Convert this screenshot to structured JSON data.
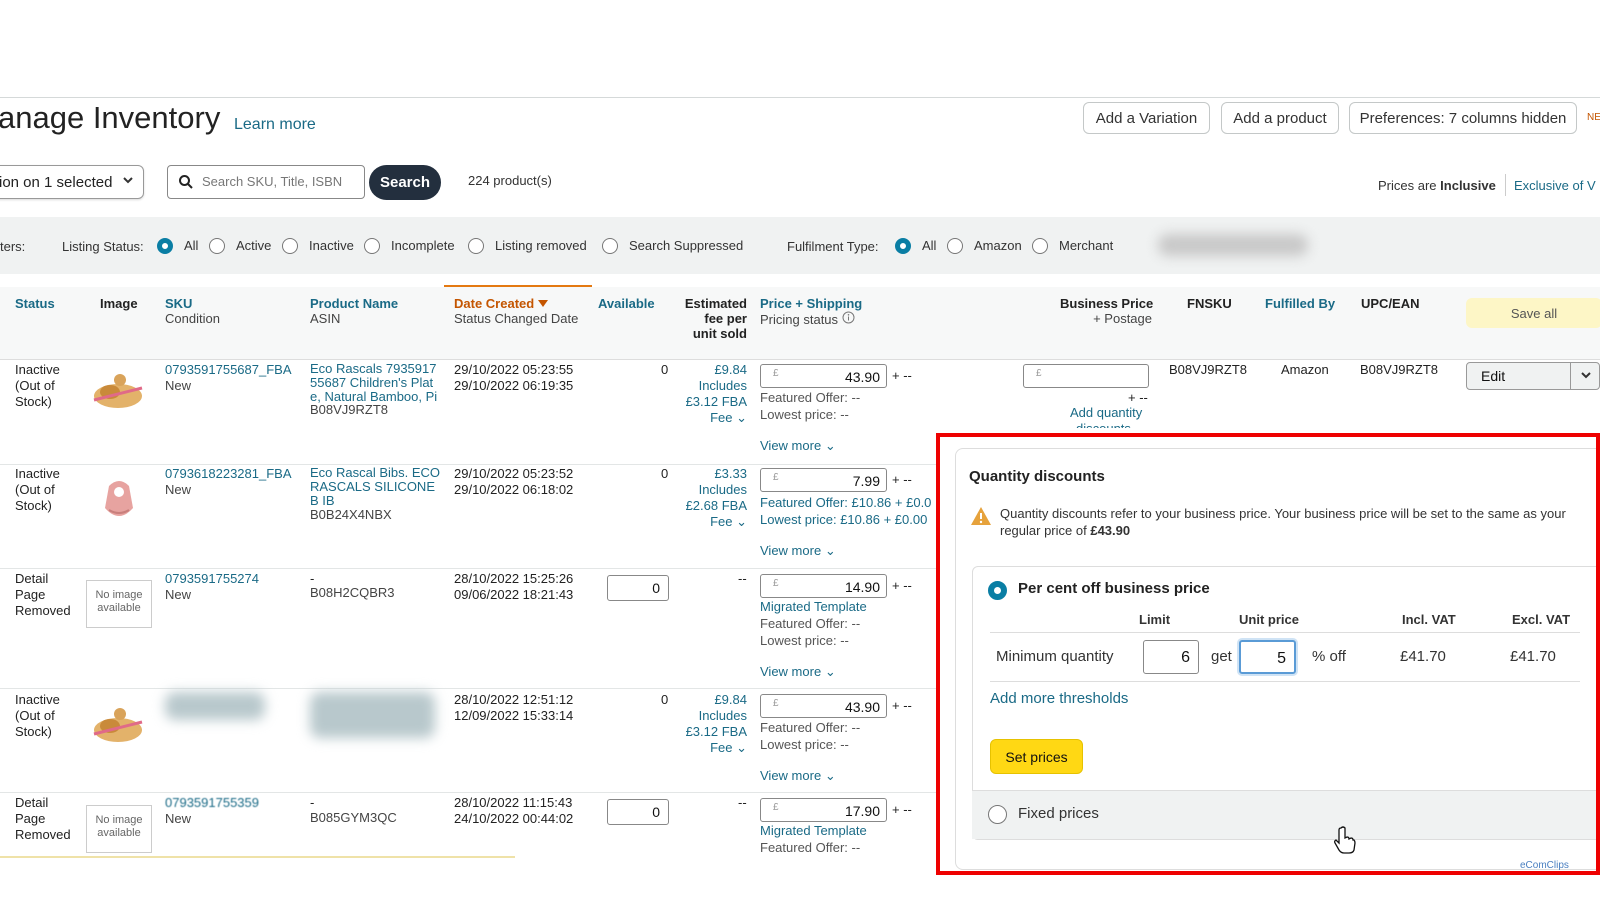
{
  "header": {
    "title": "anage Inventory",
    "learn_more": "Learn more",
    "add_variation": "Add a Variation",
    "add_product": "Add a product",
    "preferences": "Preferences: 7 columns hidden",
    "new_badge": "NE"
  },
  "toolbar": {
    "action_select": "ion on 1 selected",
    "search_placeholder": "Search SKU, Title, ISBN",
    "search_button": "Search",
    "product_count": "224 product(s)",
    "prices_are": "Prices are",
    "prices_inclusive": "Inclusive",
    "exclusive_link": "Exclusive of V"
  },
  "filters": {
    "filters_label": "ters:",
    "listing_status_label": "Listing Status:",
    "listing_options": [
      "All",
      "Active",
      "Inactive",
      "Incomplete",
      "Listing removed",
      "Search Suppressed"
    ],
    "listing_selected": "All",
    "fulfilment_label": "Fulfilment Type:",
    "fulfilment_options": [
      "All",
      "Amazon",
      "Merchant"
    ],
    "fulfilment_selected": "All"
  },
  "table": {
    "headers": {
      "status": "Status",
      "image": "Image",
      "sku": "SKU",
      "condition": "Condition",
      "product_name": "Product Name",
      "asin": "ASIN",
      "date_created": "Date Created",
      "status_changed": "Status Changed Date",
      "available": "Available",
      "fee_1": "Estimated",
      "fee_2": "fee per",
      "fee_3": "unit sold",
      "price_shipping": "Price + Shipping",
      "pricing_status": "Pricing status",
      "business_price": "Business Price",
      "postage": "+ Postage",
      "fnsku": "FNSKU",
      "fulfilled_by": "Fulfilled By",
      "upc": "UPC/EAN",
      "save_all": "Save all"
    },
    "rows": [
      {
        "status": [
          "Inactive",
          "(Out of",
          "Stock)"
        ],
        "sku": "0793591755687_FBA",
        "condition": "New",
        "name": "Eco Rascals 7935917 55687 Children's Plat e, Natural Bamboo, Pi",
        "asin": "B08VJ9RZT8",
        "date_created": "29/10/2022 05:23:55",
        "date_changed": "29/10/2022 06:19:35",
        "available": "0",
        "fee": [
          "£9.84",
          "Includes",
          "£3.12 FBA",
          "Fee"
        ],
        "price": "43.90",
        "shipping": "+ --",
        "offer1": "Featured Offer: --",
        "offer2": "Lowest price: --",
        "view_more": "View more"
      },
      {
        "status": [
          "Inactive",
          "(Out of",
          "Stock)"
        ],
        "sku": "0793618223281_FBA",
        "condition": "New",
        "name": "Eco Rascal Bibs. ECO RASCALS SILICONE B IB",
        "asin": "B0B24X4NBX",
        "date_created": "29/10/2022 05:23:52",
        "date_changed": "29/10/2022 06:18:02",
        "available": "0",
        "fee": [
          "£3.33",
          "Includes",
          "£2.68 FBA",
          "Fee"
        ],
        "price": "7.99",
        "shipping": "+ --",
        "offer1": "Featured Offer: £10.86 + £0.0",
        "offer2": "Lowest price: £10.86 + £0.00",
        "view_more": "View more"
      },
      {
        "status": [
          "Detail",
          "Page",
          "Removed"
        ],
        "no_image": [
          "No image",
          "available"
        ],
        "sku": "0793591755274",
        "condition": "New",
        "name": "-",
        "asin": "B08H2CQBR3",
        "date_created": "28/10/2022 15:25:26",
        "date_changed": "09/06/2022 18:21:43",
        "available": "0",
        "fee_dash": "--",
        "price": "14.90",
        "shipping": "+ --",
        "template": "Migrated Template",
        "offer1": "Featured Offer: --",
        "offer2": "Lowest price: --",
        "view_more": "View more"
      },
      {
        "status": [
          "Inactive",
          "(Out of",
          "Stock)"
        ],
        "date_created": "28/10/2022 12:51:12",
        "date_changed": "12/09/2022 15:33:14",
        "available": "0",
        "fee": [
          "£9.84",
          "Includes",
          "£3.12 FBA",
          "Fee"
        ],
        "price": "43.90",
        "shipping": "+ --",
        "offer1": "Featured Offer: --",
        "offer2": "Lowest price: --",
        "view_more": "View more"
      },
      {
        "status": [
          "Detail",
          "Page",
          "Removed"
        ],
        "no_image": [
          "No image",
          "available"
        ],
        "sku": "0793591755359",
        "condition": "New",
        "name": "-",
        "asin": "B085GYM3QC",
        "date_created": "28/10/2022 11:15:43",
        "date_changed": "24/10/2022 00:44:02",
        "available": "0",
        "fee_dash": "--",
        "price": "17.90",
        "shipping": "+ --",
        "template": "Migrated Template",
        "offer1": "Featured Offer: --"
      }
    ],
    "row1_extra": {
      "business_plus": "+ --",
      "add_qty": "Add quantity",
      "add_qty2": "discounts",
      "fnsku": "B08VJ9RZT8",
      "fulfilled_by": "Amazon",
      "upc": "B08VJ9RZT8",
      "edit": "Edit"
    }
  },
  "quantity_discounts": {
    "title": "Quantity discounts",
    "warning_line1": "Quantity discounts refer to your business price. Your business price will be set to the same as your",
    "warning_line2_prefix": "regular price of",
    "warning_price": "£43.90",
    "per_cent_label": "Per cent off business price",
    "col_limit": "Limit",
    "col_unit_price": "Unit price",
    "col_incl_vat": "Incl. VAT",
    "col_excl_vat": "Excl. VAT",
    "min_qty_label": "Minimum quantity",
    "min_qty_value": "6",
    "get_label": "get",
    "percent_value": "5",
    "percent_off": "% off",
    "incl_vat_value": "£41.70",
    "excl_vat_value": "£41.70",
    "add_thresholds": "Add more thresholds",
    "set_prices": "Set prices",
    "fixed_prices": "Fixed prices",
    "watermark": "eComClips"
  },
  "colors": {
    "highlight": "#e00000",
    "link": "#1a6a86",
    "accent": "#0a7ea4",
    "button_yellow": "#ffd814"
  }
}
